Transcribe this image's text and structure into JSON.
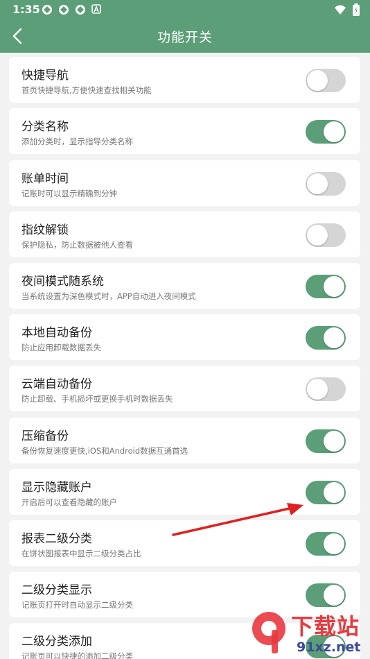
{
  "status_bar": {
    "time": "1:35",
    "notification_icons": [
      "app-icon",
      "app-icon",
      "app-icon",
      "a-icon"
    ],
    "wifi": "wifi-icon",
    "battery": "battery-icon"
  },
  "header": {
    "title": "功能开关",
    "back_icon": "chevron-left-icon"
  },
  "colors": {
    "accent": "#5b9e78",
    "toggle_off": "#d5d5d5",
    "arrow": "#e02020"
  },
  "settings": [
    {
      "title": "快捷导航",
      "description": "首页快捷导航,方便快速查找相关功能",
      "enabled": false
    },
    {
      "title": "分类名称",
      "description": "添加分类时，显示指导分类名称",
      "enabled": true
    },
    {
      "title": "账单时间",
      "description": "记账时可以显示精确到分钟",
      "enabled": false
    },
    {
      "title": "指纹解锁",
      "description": "保护隐私，防止数据被他人查看",
      "enabled": false
    },
    {
      "title": "夜间模式随系统",
      "description": "当系统设置为深色模式时，APP自动进入夜间模式",
      "enabled": true
    },
    {
      "title": "本地自动备份",
      "description": "防止应用卸载数据丢失",
      "enabled": true
    },
    {
      "title": "云端自动备份",
      "description": "防止卸载、手机损坏或更换手机时数据丢失",
      "enabled": false
    },
    {
      "title": "压缩备份",
      "description": "备份恢复速度更快,iOS和Android数据互通首选",
      "enabled": true
    },
    {
      "title": "显示隐藏账户",
      "description": "开启后可以查看隐藏的账户",
      "enabled": true
    },
    {
      "title": "报表二级分类",
      "description": "在饼状图报表中显示二级分类占比",
      "enabled": true
    },
    {
      "title": "二级分类显示",
      "description": "记账页打开时自动显示二级分类",
      "enabled": true
    },
    {
      "title": "二级分类添加",
      "description": "记账页可以快捷的添加二级分类",
      "enabled": true
    }
  ],
  "watermark": {
    "logo_text": "下载站",
    "site_text": "91xz.net"
  }
}
